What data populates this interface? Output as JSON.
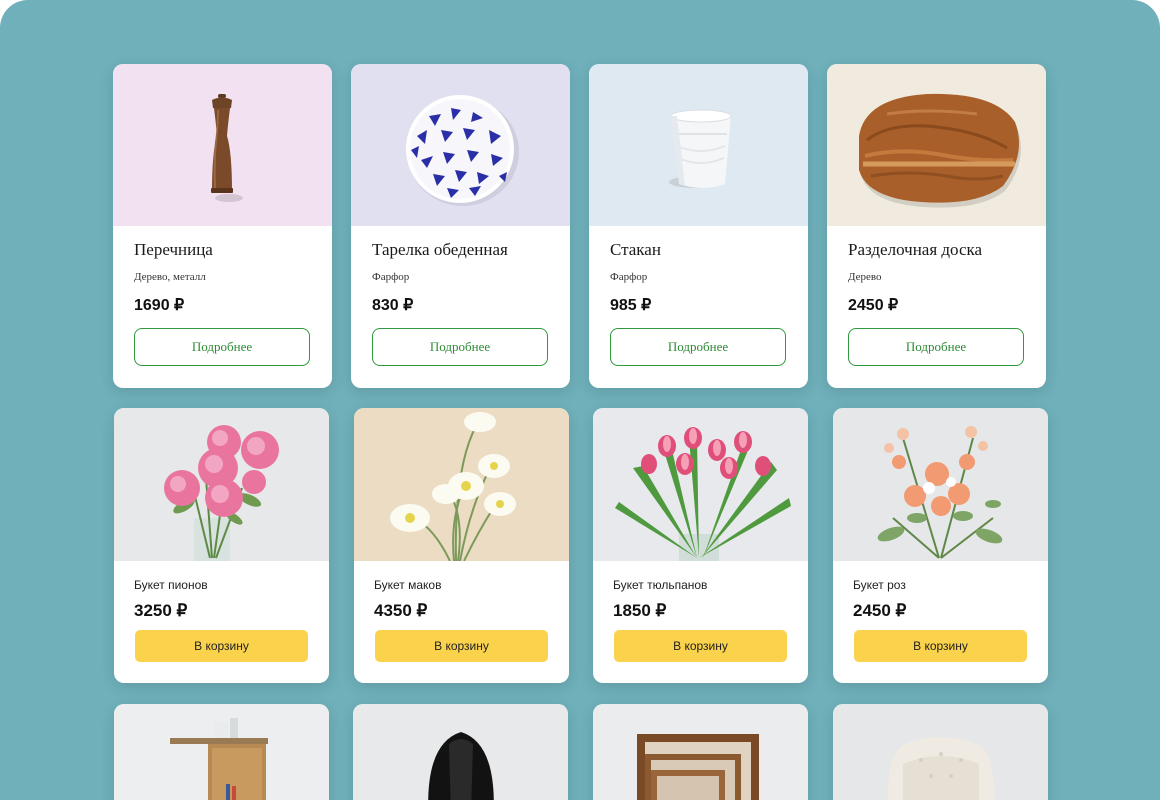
{
  "catalog": {
    "tableware": [
      {
        "name": "Перечница",
        "material": "Дерево, металл",
        "price": "1690 ₽",
        "button": "Подробнее",
        "bg": "#f2e1f0",
        "icon": "pepper-grinder-image"
      },
      {
        "name": "Тарелка обеденная",
        "material": "Фарфор",
        "price": "830 ₽",
        "button": "Подробнее",
        "bg": "#e1e0f1",
        "icon": "plate-image"
      },
      {
        "name": "Стакан",
        "material": "Фарфор",
        "price": "985 ₽",
        "button": "Подробнее",
        "bg": "#dfe9f1",
        "icon": "cup-image"
      },
      {
        "name": "Разделочная доска",
        "material": "Дерево",
        "price": "2450 ₽",
        "button": "Подробнее",
        "bg": "#f1ebdf",
        "icon": "cutting-board-image"
      }
    ],
    "flowers": [
      {
        "name": "Букет пионов",
        "price": "3250 ₽",
        "button": "В корзину",
        "icon": "peony-bouquet-image"
      },
      {
        "name": "Букет маков",
        "price": "4350 ₽",
        "button": "В корзину",
        "icon": "poppy-bouquet-image"
      },
      {
        "name": "Букет тюльпанов",
        "price": "1850 ₽",
        "button": "В корзину",
        "icon": "tulip-bouquet-image"
      },
      {
        "name": "Букет роз",
        "price": "2450 ₽",
        "button": "В корзину",
        "icon": "rose-bouquet-image"
      }
    ],
    "furniture": [
      {
        "icon": "side-table-image"
      },
      {
        "icon": "black-chair-image"
      },
      {
        "icon": "nesting-tables-image"
      },
      {
        "icon": "armchair-image"
      }
    ]
  },
  "colors": {
    "background": "#6fb0ba",
    "accent_green": "#2e9a3d",
    "button_yellow": "#fbd24c"
  }
}
